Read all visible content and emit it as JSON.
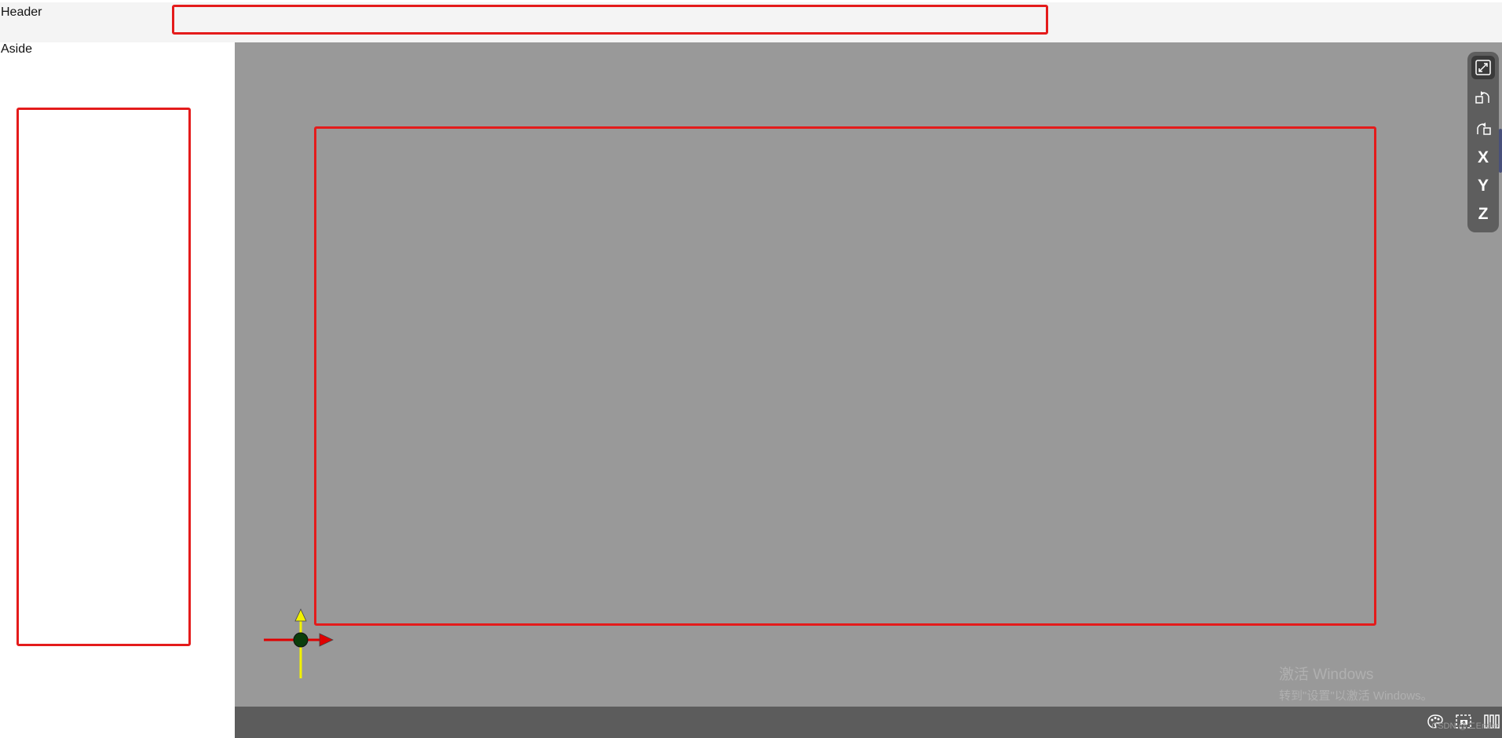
{
  "header": {
    "label": "Header"
  },
  "aside": {
    "label": "Aside"
  },
  "toolbar": {
    "buttons": [
      {
        "icon": "fit-view-icon"
      },
      {
        "icon": "rotate-left-icon"
      },
      {
        "icon": "rotate-right-icon"
      },
      {
        "label": "X"
      },
      {
        "label": "Y"
      },
      {
        "label": "Z"
      }
    ]
  },
  "viewport": {
    "background": "#999999",
    "gizmo": {
      "x_axis_color": "#e00000",
      "y_axis_color": "#f2f200",
      "origin_color": "#0b3d0b"
    }
  },
  "watermark": {
    "line1": "激活 Windows",
    "line2": "转到\"设置\"以激活 Windows。"
  },
  "statusbar": {
    "icons": [
      "palette-icon",
      "screenshot-icon",
      "columns-icon"
    ],
    "credit": "CSDN @二Ender"
  },
  "colors": {
    "highlight_box": "#e41b1b",
    "toolbar_bg": "#5e5e5e",
    "statusbar_bg": "#5c5c5c"
  }
}
